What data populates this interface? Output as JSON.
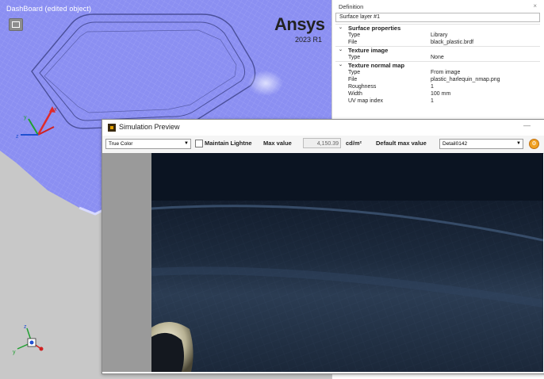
{
  "viewport": {
    "title": "DashBoard (edited object)",
    "logo": "Ansys",
    "version": "2023 R1"
  },
  "definition_panel": {
    "title": "Definition",
    "close_icon": "close-icon",
    "name_field": "Surface layer #1",
    "sections": [
      {
        "label": "Surface properties",
        "props": [
          {
            "key": "Type",
            "value": "Library"
          },
          {
            "key": "File",
            "value": "black_plastic.brdf"
          }
        ]
      },
      {
        "label": "Texture image",
        "props": [
          {
            "key": "Type",
            "value": "None"
          }
        ]
      },
      {
        "label": "Texture normal map",
        "props": [
          {
            "key": "Type",
            "value": "From image"
          },
          {
            "key": "File",
            "value": "plastic_harlequin_nmap.png"
          },
          {
            "key": "Roughness",
            "value": "1"
          },
          {
            "key": "Width",
            "value": "100 mm"
          },
          {
            "key": "UV map index",
            "value": "1"
          }
        ]
      }
    ]
  },
  "sim_preview": {
    "title": "Simulation Preview",
    "minimize_icon": "minimize-icon",
    "color_mode": "True Color",
    "maintain_label": "Maintain Lightne",
    "max_value_label": "Max value",
    "max_value": "4,150.39",
    "unit": "cd/m²",
    "default_max_label": "Default max value",
    "detail_select": "Detail0142",
    "settings_icon": "gear-icon"
  },
  "colors": {
    "viewport_surface": "#8a8ff2",
    "viewport_bg": "#c8c8c8",
    "render_surface": "#1d2b3e",
    "accent": "#f0a020"
  }
}
